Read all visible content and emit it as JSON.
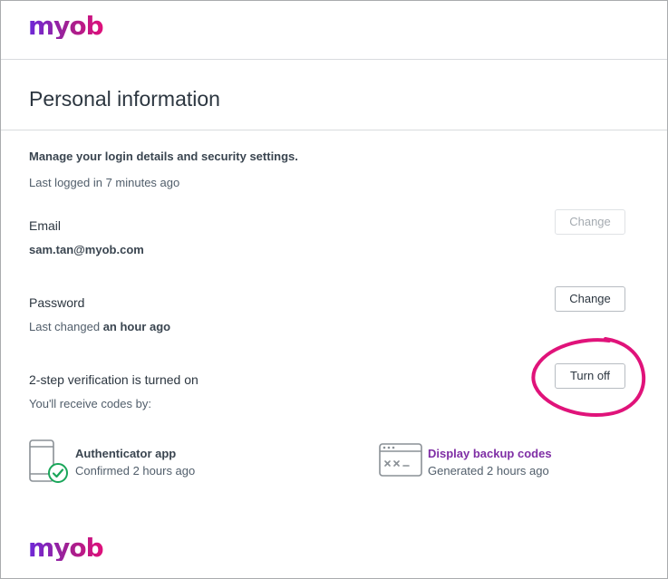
{
  "brand": {
    "logo_text": "myob"
  },
  "page": {
    "title": "Personal information"
  },
  "intro": {
    "heading": "Manage your login details and security settings.",
    "last_logged": "Last logged in 7 minutes ago"
  },
  "email": {
    "label": "Email",
    "value": "sam.tan@myob.com",
    "change_label": "Change"
  },
  "password": {
    "label": "Password",
    "last_changed_prefix": "Last changed ",
    "last_changed_value": "an hour ago",
    "change_label": "Change"
  },
  "two_step": {
    "status": "2-step verification is turned on",
    "receive_codes": "You'll receive codes by:",
    "turn_off_label": "Turn off",
    "methods": [
      {
        "icon": "phone-check-icon",
        "title": "Authenticator app",
        "subtitle": "Confirmed 2 hours ago"
      },
      {
        "icon": "browser-code-icon",
        "title": "Display backup codes",
        "subtitle": "Generated 2 hours ago"
      }
    ]
  },
  "colors": {
    "brand_purple": "#6d28d9",
    "brand_pink": "#e0107a",
    "link_purple": "#7f2ea5",
    "highlight_circle": "#e0137a",
    "check_green": "#1aa65a"
  }
}
